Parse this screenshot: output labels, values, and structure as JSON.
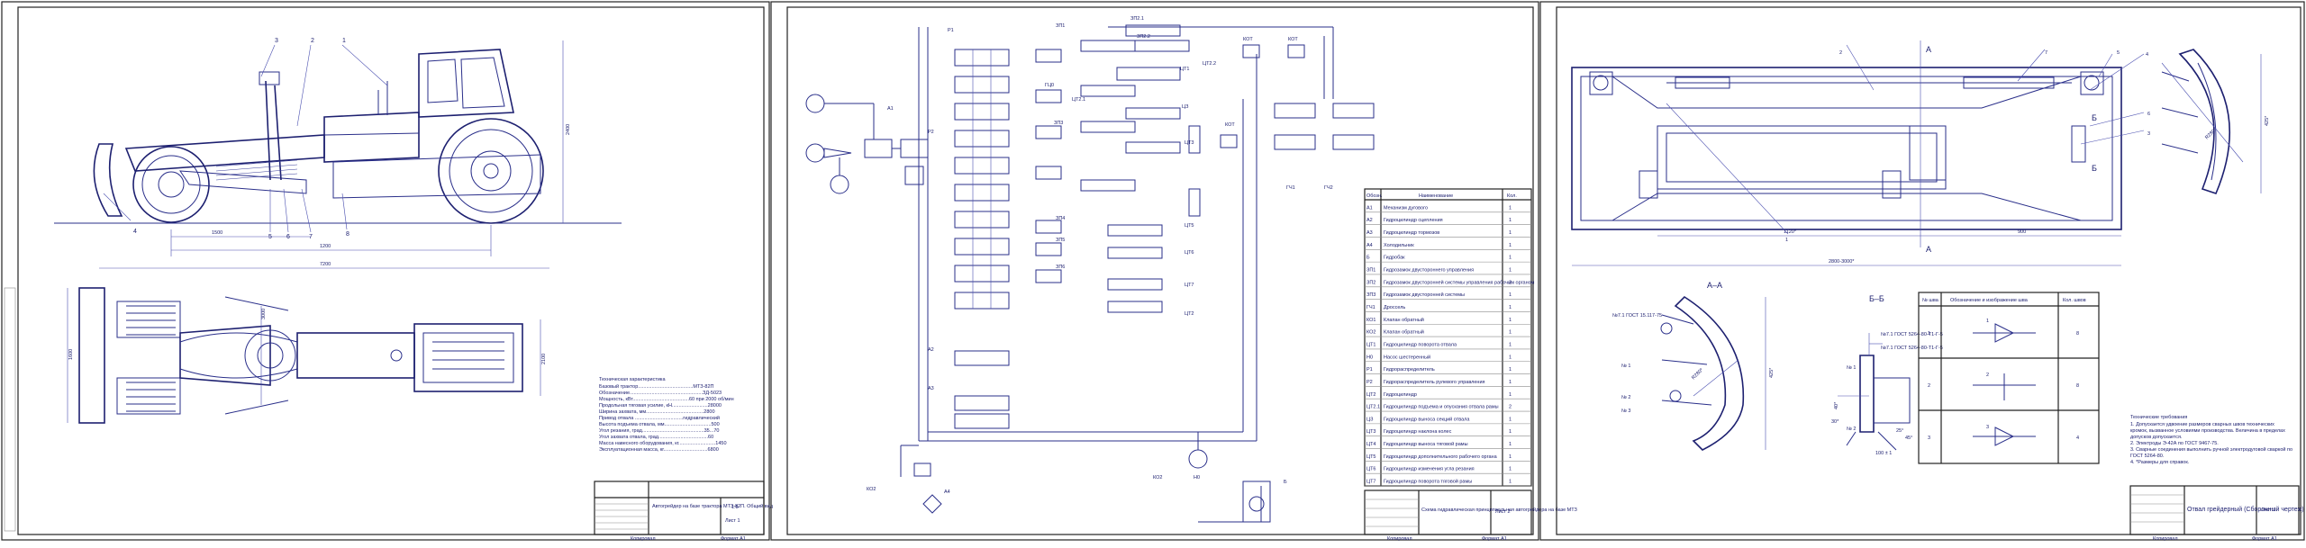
{
  "sheet1": {
    "positions": [
      "1",
      "2",
      "3",
      "4",
      "5",
      "6",
      "7",
      "8"
    ],
    "dims": [
      "2400",
      "1500",
      "1200",
      "7200",
      "1600",
      "2100",
      "3000"
    ],
    "spec_title": "Техническая характеристика",
    "spec_lines": [
      "Базовый трактор........................................МТЗ-82П",
      "Обозначение.....................................................ЗД-5023",
      "Мощность, кВт.........................................60 при 2000 об/мин",
      "Продольная тяговая усилие, кН..........................28000",
      "Ширина захвата, мм..........................................2800",
      "Привод отвала ...................................гидравлический",
      "Высота подъема отвала, мм..................................500",
      "Угол резания, град.............................................35...70",
      "Угол захвата отвала, град....................................60",
      "Масса навесного оборудования, кг...........................1450",
      "Эксплуатационная масса, кг................................6800"
    ],
    "title_block": {
      "name": "Автогрейдер на базе трактора МТЗ-82П. Общий вид",
      "mass": "1:5",
      "sheet": "Лист 1",
      "footer_left": "Копировал",
      "footer_right": "Формат А1"
    }
  },
  "sheet2": {
    "labels": [
      "Р1",
      "ЗП1",
      "ЗП2.1",
      "ЗП2.2",
      "КОТ",
      "КОТ",
      "ГЦ0",
      "ЦТ1",
      "ЦТ2.2",
      "ЦТ2.1",
      "ЦЗ",
      "ЗП3",
      "ЦТ3",
      "ЗП4",
      "ЗП5",
      "ЗП6",
      "ЦТ5",
      "ЦТ6",
      "ЦТ7",
      "ЦТ2",
      "КОТ",
      "ГЧ1",
      "ГЧ2",
      "А1",
      "Р2",
      "А2",
      "А3",
      "КО2",
      "А4",
      "КО2",
      "Н0",
      "Б"
    ],
    "table_headers": [
      "Обозн.",
      "Наименование",
      "Кол."
    ],
    "table_rows": [
      [
        "А1",
        "Механизм дугового",
        "1"
      ],
      [
        "А2",
        "Гидроцилиндр сцепления",
        "1"
      ],
      [
        "А3",
        "Гидроцилиндр тормозов",
        "1"
      ],
      [
        "А4",
        "Холодильник",
        "1"
      ],
      [
        "Б",
        "Гидробак",
        "1"
      ],
      [
        "ЗП1",
        "Гидрозамок двустороннего управления",
        "1"
      ],
      [
        "ЗП2",
        "Гидрозамок двусторонней системы управления рабочим органом",
        "2"
      ],
      [
        "ЗП3",
        "Гидрозамок двусторонней системы",
        "1"
      ],
      [
        "ГЧ1",
        "Дроссель",
        "1"
      ],
      [
        "КО1",
        "Клапан обратный",
        "1"
      ],
      [
        "КО2",
        "Клапан обратный",
        "1"
      ],
      [
        "ЦТ1",
        "Гидроцилиндр поворота отвала",
        "1"
      ],
      [
        "Н0",
        "Насос шестеренный",
        "1"
      ],
      [
        "Р1",
        "Гидрораспределитель",
        "1"
      ],
      [
        "Р2",
        "Гидрораспределитель рулевого управления",
        "1"
      ],
      [
        "ЦТ2",
        "Гидроцилиндр",
        "1"
      ],
      [
        "ЦТ2.1",
        "Гидроцилиндр подъема и опускания отвала рамы",
        "2"
      ],
      [
        "ЦЗ",
        "Гидроцилиндр выноса секций отвала",
        "1"
      ],
      [
        "ЦТ3",
        "Гидроцилиндр наклона колес",
        "1"
      ],
      [
        "ЦТ4",
        "Гидроцилиндр выноса тяговой рамы",
        "1"
      ],
      [
        "ЦТ5",
        "Гидроцилиндр дополнительного рабочего органа",
        "1"
      ],
      [
        "ЦТ6",
        "Гидроцилиндр изменения угла резания",
        "1"
      ],
      [
        "ЦТ7",
        "Гидроцилиндр поворота тяговой рамы",
        "1"
      ]
    ],
    "title_block": {
      "name": "Схема гидравлическая принципиальная автогрейдера на базе МТЗ",
      "sheet": "Лист 2",
      "footer_left": "Копировал",
      "footer_right": "Формат А1"
    }
  },
  "sheet3": {
    "positions": [
      "1",
      "2",
      "3",
      "4",
      "5",
      "6",
      "7"
    ],
    "cut_marks": [
      "А",
      "А",
      "Б",
      "Б"
    ],
    "dims_main": [
      "2800-3000*",
      "1120*",
      "900",
      "425*",
      "R280*"
    ],
    "section_a": "А–А",
    "section_b": "Б–Б",
    "section_a_labels": [
      "№7.1 ГОСТ 15.117-75",
      "№ 1",
      "№ 2",
      "№ 3",
      "R280*",
      "425*"
    ],
    "section_b_labels": [
      "№7.1 ГОСТ 5264-80-Т1-Г-5",
      "№7.1 ГОСТ 5264-80-Т1-Г-5",
      "№ 1",
      "№ 2",
      "45°",
      "30*",
      "25°",
      "100 ± 1",
      "40*"
    ],
    "weld_table_headers": [
      "№ шва",
      "Обозначение и изображение шва",
      "Кол. швов"
    ],
    "weld_table_rows": [
      [
        "1",
        "1",
        "8"
      ],
      [
        "2",
        "2",
        "8"
      ],
      [
        "3",
        "3",
        "4"
      ]
    ],
    "tech_req_title": "Технические требования",
    "tech_req_lines": [
      "1. Допускается удвоение размеров сварных швов технических",
      "кромок, вызванное условиями производства. Величина в пределах",
      "допусков допускается.",
      "2. Электроды Э-42А по ГОСТ 9467-75.",
      "3. Сварные соединения выполнить ручной электродуговой сваркой по",
      "ГОСТ 5264-80.",
      "4. *Размеры для справок."
    ],
    "title_block": {
      "name": "Отвал грейдерный (Сборочный чертеж)",
      "sheet": "Лист 3",
      "footer_left": "Копировал",
      "footer_right": "Формат А1"
    }
  },
  "colors": {
    "ink": "#1d2070",
    "frame": "#222222",
    "paper": "#ffffff"
  }
}
